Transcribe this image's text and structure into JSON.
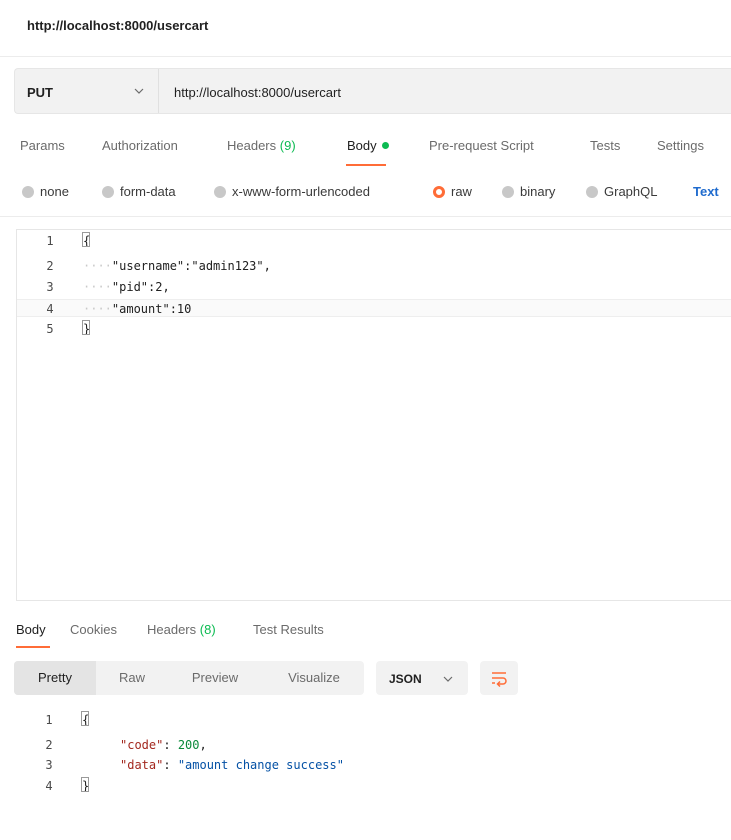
{
  "window": {
    "title": "http://localhost:8000/usercart"
  },
  "request": {
    "method": "PUT",
    "url": "http://localhost:8000/usercart"
  },
  "request_tabs": {
    "params": "Params",
    "authorization": "Authorization",
    "headers_label": "Headers",
    "headers_count": "(9)",
    "body": "Body",
    "pre_request": "Pre-request Script",
    "tests": "Tests",
    "settings": "Settings"
  },
  "body_types": {
    "none": "none",
    "form_data": "form-data",
    "urlencoded": "x-www-form-urlencoded",
    "raw": "raw",
    "binary": "binary",
    "graphql": "GraphQL",
    "selected_format": "Text"
  },
  "request_body": {
    "line_numbers": [
      "1",
      "2",
      "3",
      "4",
      "5"
    ],
    "line2_key": "\"username\"",
    "line2_rest": ":\"admin123\",",
    "line3_key": "\"pid\"",
    "line3_rest": ":2,",
    "line4_key": "\"amount\"",
    "line4_rest": ":10"
  },
  "response_tabs": {
    "body": "Body",
    "cookies": "Cookies",
    "headers_label": "Headers",
    "headers_count": "(8)",
    "test_results": "Test Results"
  },
  "response_view": {
    "pretty": "Pretty",
    "raw": "Raw",
    "preview": "Preview",
    "visualize": "Visualize",
    "format": "JSON"
  },
  "response_body": {
    "line_numbers": [
      "1",
      "2",
      "3",
      "4"
    ],
    "code_key": "\"code\"",
    "code_value": "200",
    "data_key": "\"data\"",
    "data_value": "\"amount change success\""
  },
  "colors": {
    "accent": "#ff6c37",
    "status_green": "#0cbb52",
    "link_blue": "#1f6bce"
  },
  "icons": [
    "chevron-down-icon",
    "status-dot-icon",
    "radio-icon",
    "wrap-lines-icon"
  ]
}
